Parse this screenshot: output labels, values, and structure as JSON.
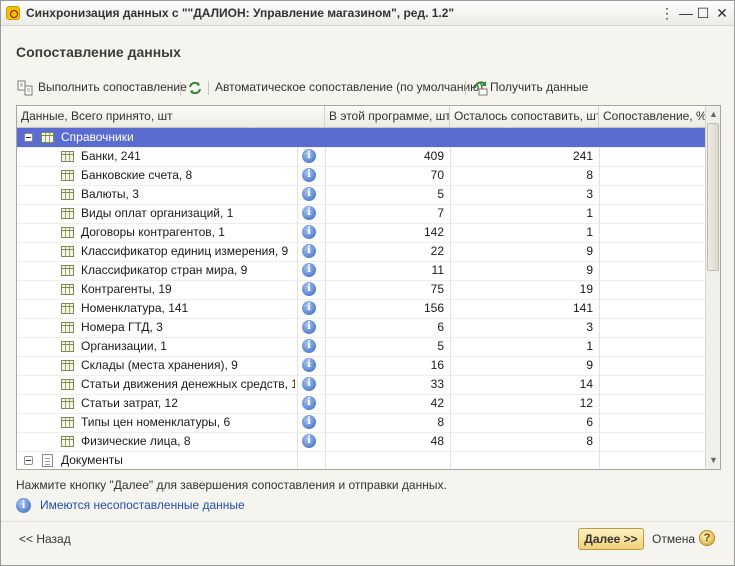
{
  "window": {
    "title": "Синхронизация данных с \"\"ДАЛИОН: Управление магазином\", ред. 1.2\"",
    "controls": {
      "dots": "⋮",
      "minimize": "—",
      "maximize": "☐",
      "close": "✕"
    }
  },
  "page": {
    "header": "Сопоставление данных"
  },
  "toolbar": {
    "run_label": "Выполнить сопоставление",
    "auto_label": "Автоматическое сопоставление (по умолчанию)",
    "get_data_label": "Получить данные"
  },
  "table": {
    "columns": [
      "Данные, Всего принято, шт",
      "В этой программе, шт",
      "Осталось сопоставить, шт",
      "Сопоставление, %"
    ],
    "group_catalogs": "Справочники",
    "rows": [
      {
        "name": "Банки, 241",
        "in_program": "409",
        "remaining": "241"
      },
      {
        "name": "Банковские счета, 8",
        "in_program": "70",
        "remaining": "8"
      },
      {
        "name": "Валюты, 3",
        "in_program": "5",
        "remaining": "3"
      },
      {
        "name": "Виды оплат организаций, 1",
        "in_program": "7",
        "remaining": "1"
      },
      {
        "name": "Договоры контрагентов, 1",
        "in_program": "142",
        "remaining": "1"
      },
      {
        "name": "Классификатор единиц измерения, 9",
        "in_program": "22",
        "remaining": "9"
      },
      {
        "name": "Классификатор стран мира, 9",
        "in_program": "11",
        "remaining": "9"
      },
      {
        "name": "Контрагенты, 19",
        "in_program": "75",
        "remaining": "19"
      },
      {
        "name": "Номенклатура, 141",
        "in_program": "156",
        "remaining": "141"
      },
      {
        "name": "Номера ГТД, 3",
        "in_program": "6",
        "remaining": "3"
      },
      {
        "name": "Организации, 1",
        "in_program": "5",
        "remaining": "1"
      },
      {
        "name": "Склады (места хранения), 9",
        "in_program": "16",
        "remaining": "9"
      },
      {
        "name": "Статьи движения денежных средств, 14",
        "in_program": "33",
        "remaining": "14"
      },
      {
        "name": "Статьи затрат, 12",
        "in_program": "42",
        "remaining": "12"
      },
      {
        "name": "Типы цен номенклатуры, 6",
        "in_program": "8",
        "remaining": "6"
      },
      {
        "name": "Физические лица, 8",
        "in_program": "48",
        "remaining": "8"
      }
    ],
    "group_documents": "Документы"
  },
  "hint": "Нажмите кнопку \"Далее\" для завершения сопоставления и отправки данных.",
  "warning_link": "Имеются несопоставленные данные",
  "footer": {
    "back_label": "<< Назад",
    "next_label": "Далее >>",
    "cancel_label": "Отмена",
    "help_label": "?"
  },
  "colors": {
    "selection": "#5a6ccf",
    "next_button": "#f1d178",
    "link": "#1f4fb0"
  },
  "icons": {
    "app": "1c-app-icon",
    "row_type": "table-icon",
    "info": "info-icon",
    "documents": "document-icon",
    "help": "help-icon"
  }
}
